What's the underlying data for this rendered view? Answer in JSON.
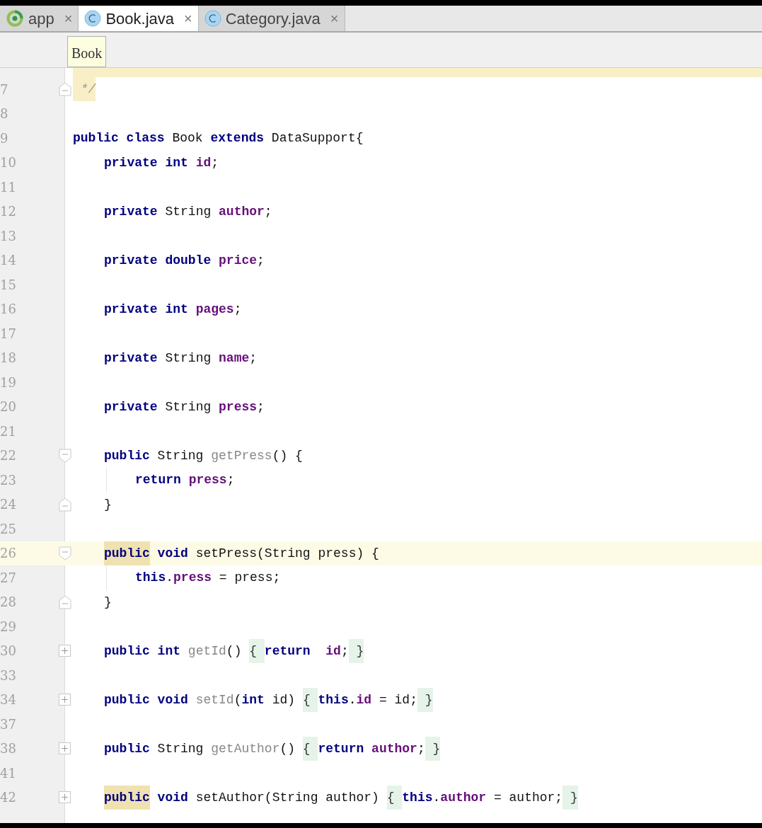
{
  "tabs": [
    {
      "label": "app",
      "kind": "module",
      "selected": false,
      "close": "×"
    },
    {
      "label": "Book.java",
      "kind": "class",
      "selected": true,
      "close": "×"
    },
    {
      "label": "Category.java",
      "kind": "class",
      "selected": false,
      "close": "×"
    }
  ],
  "breadcrumb": {
    "label": "Book"
  },
  "lines": [
    {
      "number": "7",
      "kind": "fold_end",
      "current": false,
      "tokens": [
        {
          "text": " */",
          "kind": "comment"
        }
      ]
    },
    {
      "number": "8",
      "kind": "plain",
      "current": false
    },
    {
      "number": "9",
      "kind": "plain",
      "current": false,
      "tokens": [
        {
          "text": "public class",
          "kind": "kw"
        },
        {
          "text": " Book ",
          "kind": "plain"
        },
        {
          "text": "extends",
          "kind": "kw"
        },
        {
          "text": " DataSupport{",
          "kind": "plain"
        }
      ],
      "children": [
        {
          "number": "10",
          "kind": "plain",
          "current": false,
          "tokens": [
            {
              "text": "private int ",
              "kind": "kw"
            },
            {
              "text": "id",
              "kind": "field"
            },
            {
              "text": ";",
              "kind": "plain"
            }
          ]
        },
        {
          "number": "11",
          "kind": "plain",
          "current": false
        },
        {
          "number": "12",
          "kind": "plain",
          "current": false,
          "tokens": [
            {
              "text": "private",
              "kind": "kw"
            },
            {
              "text": " String ",
              "kind": "plain"
            },
            {
              "text": "author",
              "kind": "field"
            },
            {
              "text": ";",
              "kind": "plain"
            }
          ]
        },
        {
          "number": "13",
          "kind": "plain",
          "current": false
        },
        {
          "number": "14",
          "kind": "plain",
          "current": false,
          "tokens": [
            {
              "text": "private double ",
              "kind": "kw"
            },
            {
              "text": "price",
              "kind": "field"
            },
            {
              "text": ";",
              "kind": "plain"
            }
          ]
        },
        {
          "number": "15",
          "kind": "plain",
          "current": false
        },
        {
          "number": "16",
          "kind": "plain",
          "current": false,
          "tokens": [
            {
              "text": "private int ",
              "kind": "kw"
            },
            {
              "text": "pages",
              "kind": "field"
            },
            {
              "text": ";",
              "kind": "plain"
            }
          ]
        },
        {
          "number": "17",
          "kind": "plain",
          "current": false
        },
        {
          "number": "18",
          "kind": "plain",
          "current": false,
          "tokens": [
            {
              "text": "private",
              "kind": "kw"
            },
            {
              "text": " String ",
              "kind": "plain"
            },
            {
              "text": "name",
              "kind": "field"
            },
            {
              "text": ";",
              "kind": "plain"
            }
          ]
        },
        {
          "number": "19",
          "kind": "plain",
          "current": false
        },
        {
          "number": "20",
          "kind": "plain",
          "current": false,
          "tokens": [
            {
              "text": "private",
              "kind": "kw"
            },
            {
              "text": " String ",
              "kind": "plain"
            },
            {
              "text": "press",
              "kind": "field"
            },
            {
              "text": ";",
              "kind": "plain"
            }
          ]
        },
        {
          "number": "21",
          "kind": "plain",
          "current": false
        },
        {
          "number": "22",
          "kind": "fold_start",
          "current": false,
          "tokens": [
            {
              "text": "public",
              "kind": "kw"
            },
            {
              "text": " String ",
              "kind": "plain"
            },
            {
              "text": "getPress",
              "kind": "unused"
            },
            {
              "text": "() {",
              "kind": "plain"
            }
          ],
          "children": [
            {
              "number": "23",
              "kind": "guide",
              "current": false,
              "tokens": [
                {
                  "text": "return ",
                  "kind": "kw"
                },
                {
                  "text": "press",
                  "kind": "field"
                },
                {
                  "text": ";",
                  "kind": "plain"
                }
              ]
            }
          ]
        },
        {
          "number": "24",
          "kind": "fold_end",
          "current": false,
          "tokens": [
            {
              "text": "}",
              "kind": "plain"
            }
          ]
        },
        {
          "number": "25",
          "kind": "plain",
          "current": false
        },
        {
          "number": "26",
          "kind": "fold_start",
          "current": true,
          "tokens": [
            {
              "text": "public",
              "kind": "kw_mark"
            },
            {
              "text": " void",
              "kind": "kw"
            },
            {
              "text": " setPress(String press) {",
              "kind": "plain"
            }
          ],
          "children": [
            {
              "number": "27",
              "kind": "guide",
              "current": false,
              "tokens": [
                {
                  "text": "this",
                  "kind": "kw"
                },
                {
                  "text": ".",
                  "kind": "plain"
                },
                {
                  "text": "press",
                  "kind": "field"
                },
                {
                  "text": " = press;",
                  "kind": "plain"
                }
              ]
            }
          ]
        },
        {
          "number": "28",
          "kind": "fold_end",
          "current": false,
          "tokens": [
            {
              "text": "}",
              "kind": "plain"
            }
          ]
        },
        {
          "number": "29",
          "kind": "plain",
          "current": false
        },
        {
          "number": "30",
          "kind": "folded",
          "current": false,
          "tokens": [
            {
              "text": "public int ",
              "kind": "kw"
            },
            {
              "text": "getId",
              "kind": "unused"
            },
            {
              "text": "() ",
              "kind": "plain"
            },
            {
              "text": "{ ",
              "kind": "folded"
            },
            {
              "text": "return  ",
              "kind": "kw"
            },
            {
              "text": "id",
              "kind": "field"
            },
            {
              "text": ";",
              "kind": "plain"
            },
            {
              "text": " }",
              "kind": "folded"
            }
          ]
        },
        {
          "number": "33",
          "kind": "plain",
          "current": false
        },
        {
          "number": "34",
          "kind": "folded",
          "current": false,
          "tokens": [
            {
              "text": "public void ",
              "kind": "kw"
            },
            {
              "text": "setId",
              "kind": "unused"
            },
            {
              "text": "(",
              "kind": "plain"
            },
            {
              "text": "int",
              "kind": "kw"
            },
            {
              "text": " id) ",
              "kind": "plain"
            },
            {
              "text": "{ ",
              "kind": "folded"
            },
            {
              "text": "this",
              "kind": "kw"
            },
            {
              "text": ".",
              "kind": "plain"
            },
            {
              "text": "id",
              "kind": "field"
            },
            {
              "text": " = id;",
              "kind": "plain"
            },
            {
              "text": " }",
              "kind": "folded"
            }
          ]
        },
        {
          "number": "37",
          "kind": "plain",
          "current": false
        },
        {
          "number": "38",
          "kind": "folded",
          "current": false,
          "tokens": [
            {
              "text": "public",
              "kind": "kw"
            },
            {
              "text": " String ",
              "kind": "plain"
            },
            {
              "text": "getAuthor",
              "kind": "unused"
            },
            {
              "text": "() ",
              "kind": "plain"
            },
            {
              "text": "{ ",
              "kind": "folded"
            },
            {
              "text": "return ",
              "kind": "kw"
            },
            {
              "text": "author",
              "kind": "field"
            },
            {
              "text": ";",
              "kind": "plain"
            },
            {
              "text": " }",
              "kind": "folded"
            }
          ]
        },
        {
          "number": "41",
          "kind": "plain",
          "current": false
        },
        {
          "number": "42",
          "kind": "folded",
          "current": false,
          "tokens": [
            {
              "text": "public",
              "kind": "kw_mark"
            },
            {
              "text": " void",
              "kind": "kw"
            },
            {
              "text": " setAuthor(String author) ",
              "kind": "plain"
            },
            {
              "text": "{ ",
              "kind": "folded"
            },
            {
              "text": "this",
              "kind": "kw"
            },
            {
              "text": ".",
              "kind": "plain"
            },
            {
              "text": "author",
              "kind": "field"
            },
            {
              "text": " = author;",
              "kind": "plain"
            },
            {
              "text": " }",
              "kind": "folded"
            }
          ]
        }
      ]
    }
  ]
}
